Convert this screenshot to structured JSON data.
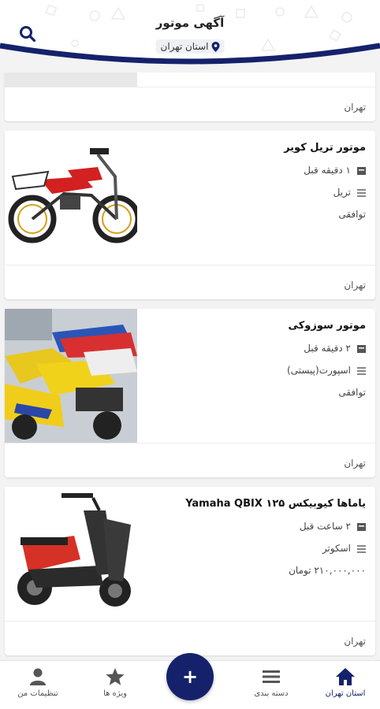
{
  "header": {
    "title": "آگهی موتور",
    "location": "استان تهران",
    "search_icon": "search-icon",
    "location_icon": "map-pin-icon",
    "accent_color": "#15226b"
  },
  "listings": [
    {
      "title": "",
      "time": "",
      "category": "",
      "price": "",
      "city": "تهران"
    },
    {
      "title": "موتور تریل کویر",
      "time": "۱ دقیقه قبل",
      "category": "تریل",
      "price": "توافقی",
      "city": "تهران"
    },
    {
      "title": "موتور سوزوکی",
      "time": "۲ دقیقه قبل",
      "category": "اسپورت(پیستی)",
      "price": "توافقی",
      "city": "تهران"
    },
    {
      "title": "یاماها کیوبیکس ۱۲۵ Yamaha QBIX",
      "time": "۲ ساعت قبل",
      "category": "اسکوتر",
      "price": "۲۱۰,۰۰۰,۰۰۰ تومان",
      "city": "تهران"
    }
  ],
  "bottom_nav": {
    "items": [
      {
        "label": "استان تهران",
        "icon": "home-icon"
      },
      {
        "label": "دسته بندی",
        "icon": "list-icon"
      },
      {
        "label": "ویژه ها",
        "icon": "star-icon"
      },
      {
        "label": "تنظیمات من",
        "icon": "user-icon"
      }
    ],
    "add_label": "+"
  }
}
